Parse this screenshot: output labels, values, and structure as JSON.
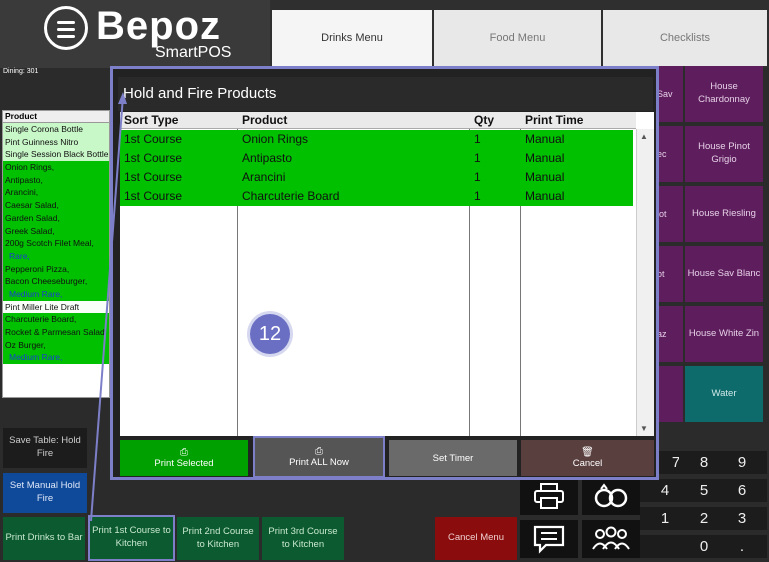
{
  "logo": {
    "brand": "Bepoz",
    "sub": "SmartPOS"
  },
  "tabs": [
    {
      "label": "Drinks Menu"
    },
    {
      "label": "Food Menu"
    },
    {
      "label": "Checklists"
    }
  ],
  "dining": "Dining: 301",
  "product_list": {
    "header": "Product",
    "rows": [
      "Single Corona Bottle",
      "Pint Guinness Nitro",
      "Single Session Black Bottle",
      "Onion Rings,",
      "Antipasto,",
      "Arancini,",
      "Caesar Salad,",
      "Garden Salad,",
      "Greek Salad,",
      "200g Scotch Filet Meal,",
      "Rare,",
      "Pepperoni Pizza,",
      "Bacon Cheeseburger,",
      "Medium Rare,",
      "Pint Miller Lite Draft",
      "Charcuterie Board,",
      "Rocket & Parmesan Salad",
      "Oz Burger,",
      "Medium Rare,"
    ]
  },
  "left_buttons": {
    "save_table": "Save Table: Hold Fire",
    "set_manual": "Set Manual Hold Fire",
    "print_drinks": "Print Drinks to Bar",
    "print_1st": "Print 1st Course to Kitchen",
    "print_2nd": "Print 2nd Course to Kitchen",
    "print_3rd": "Print 3rd Course to Kitchen"
  },
  "right_buttons": [
    {
      "stub": "Sav",
      "label": "House Chardonnay"
    },
    {
      "stub": "ec",
      "label": "House Pinot Grigio"
    },
    {
      "stub": "lot",
      "label": "House Riesling"
    },
    {
      "stub": "ot",
      "label": "House Sav Blanc"
    },
    {
      "stub": "az",
      "label": "House White Zin"
    },
    {
      "stub": "",
      "label": "Water"
    }
  ],
  "cancel_menu": "Cancel Menu",
  "keypad": [
    "7",
    "8",
    "9",
    "4",
    "5",
    "6",
    "1",
    "2",
    "3",
    "0",
    "."
  ],
  "modal": {
    "title": "Hold and Fire Products",
    "columns": [
      "Sort Type",
      "Product",
      "Qty",
      "Print Time"
    ],
    "rows": [
      [
        "1st Course",
        "Onion Rings",
        "1",
        "Manual"
      ],
      [
        "1st Course",
        "Antipasto",
        "1",
        "Manual"
      ],
      [
        "1st Course",
        "Arancini",
        "1",
        "Manual"
      ],
      [
        "1st Course",
        "Charcuterie Board",
        "1",
        "Manual"
      ]
    ],
    "buttons": {
      "print_selected": "Print Selected",
      "print_all": "Print ALL Now",
      "set_timer": "Set Timer",
      "cancel": "Cancel"
    }
  },
  "marker": "12",
  "colors": {
    "highlight": "#7d80c8",
    "green": "#00c000",
    "purple": "#5e1e5e",
    "teal": "#0e6b6b"
  }
}
